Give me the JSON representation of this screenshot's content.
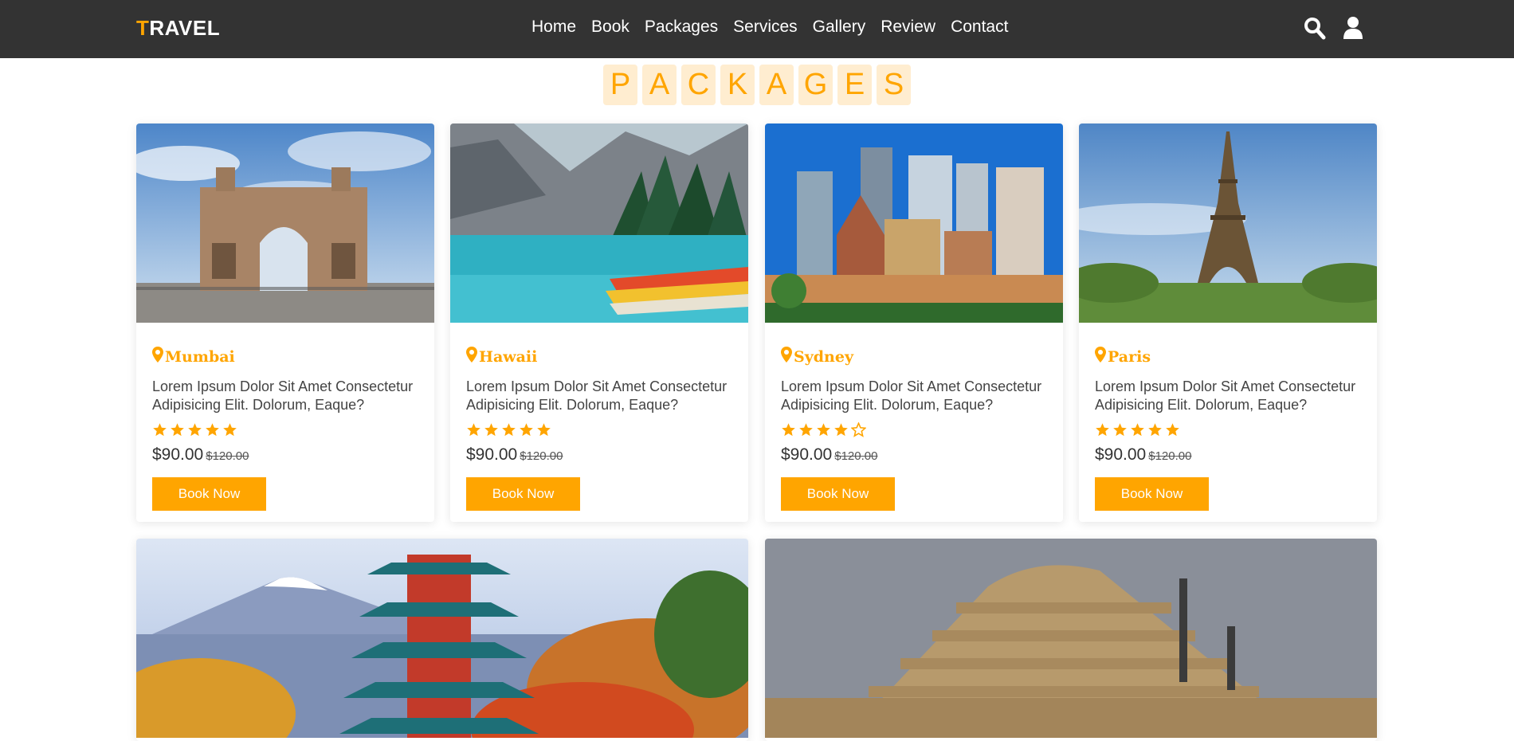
{
  "brand": {
    "first_letter": "T",
    "rest": "RAVEL"
  },
  "nav": {
    "links": [
      "Home",
      "Book",
      "Packages",
      "Services",
      "Gallery",
      "Review",
      "Contact"
    ],
    "icons": [
      "search-icon",
      "user-icon"
    ]
  },
  "section_title": [
    "P",
    "A",
    "C",
    "K",
    "A",
    "G",
    "E",
    "S"
  ],
  "colors": {
    "accent": "#ffa500",
    "nav_bg": "#333333",
    "title_tile_bg": "#ffedd0"
  },
  "packages": [
    {
      "location": "Mumbai",
      "description": "Lorem Ipsum Dolor Sit Amet Consectetur Adipisicing Elit. Dolorum, Eaque?",
      "rating": 5,
      "price": "$90.00",
      "old_price": "$120.00",
      "button": "Book Now",
      "image": "gateway-of-india-photo"
    },
    {
      "location": "Hawaii",
      "description": "Lorem Ipsum Dolor Sit Amet Consectetur Adipisicing Elit. Dolorum, Eaque?",
      "rating": 5,
      "price": "$90.00",
      "old_price": "$120.00",
      "button": "Book Now",
      "image": "mountain-lake-canoes-photo"
    },
    {
      "location": "Sydney",
      "description": "Lorem Ipsum Dolor Sit Amet Consectetur Adipisicing Elit. Dolorum, Eaque?",
      "rating": 4,
      "price": "$90.00",
      "old_price": "$120.00",
      "button": "Book Now",
      "image": "sydney-skyline-photo"
    },
    {
      "location": "Paris",
      "description": "Lorem Ipsum Dolor Sit Amet Consectetur Adipisicing Elit. Dolorum, Eaque?",
      "rating": 5,
      "price": "$90.00",
      "old_price": "$120.00",
      "button": "Book Now",
      "image": "eiffel-tower-photo"
    }
  ],
  "wide_packages": [
    {
      "image": "japanese-pagoda-fuji-photo"
    },
    {
      "image": "step-pyramid-photo"
    }
  ]
}
